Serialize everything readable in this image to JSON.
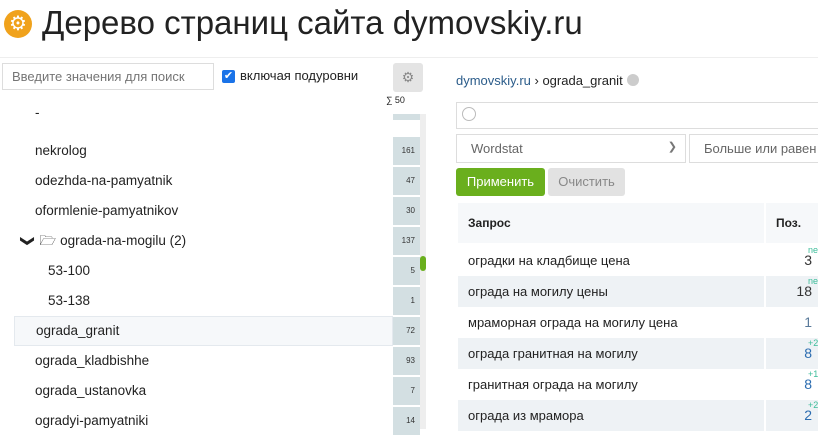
{
  "header": {
    "title": "Дерево страниц сайта dymovskiy.ru",
    "logo_icon": "gear-icon"
  },
  "left": {
    "search_placeholder": "Введите значения для поиск",
    "include_sublevels": "включая подуровни",
    "sum": "∑ 50",
    "rows": [
      {
        "label": "-",
        "count": ""
      },
      {
        "label": "nekrolog",
        "count": "161"
      },
      {
        "label": "odezhda-na-pamyatnik",
        "count": "47"
      },
      {
        "label": "oformlenie-pamyatnikov",
        "count": "30"
      },
      {
        "label": "ograda-na-mogilu (2)",
        "count": "137"
      },
      {
        "label": "53-100",
        "count": "5"
      },
      {
        "label": "53-138",
        "count": "1"
      },
      {
        "label": "ograda_granit",
        "count": "72"
      },
      {
        "label": "ograda_kladbishhe",
        "count": "93"
      },
      {
        "label": "ograda_ustanovka",
        "count": "7"
      },
      {
        "label": "ogradyi-pamyatniki",
        "count": "14"
      }
    ]
  },
  "right": {
    "crumb_root": "dymovskiy.ru",
    "crumb_sep": " › ",
    "crumb_page": "ograda_granit",
    "filter_select": "Wordstat",
    "filter_op": "Больше или равен",
    "apply": "Применить",
    "clear": "Очистить",
    "columns": [
      "Запрос",
      "Поз."
    ],
    "rows": [
      {
        "query": "оградки на кладбище цена",
        "pos": "3",
        "delta": "new",
        "color": "#333333"
      },
      {
        "query": "ограда на могилу цены",
        "pos": "18",
        "delta": "new",
        "color": "#333333"
      },
      {
        "query": "мраморная ограда на могилу цена",
        "pos": "1",
        "delta": "",
        "color": "#5a7a9a"
      },
      {
        "query": "ограда гранитная на могилу",
        "pos": "8",
        "delta": "+2",
        "color": "#2b6cb0"
      },
      {
        "query": "гранитная ограда на могилу",
        "pos": "8",
        "delta": "+1",
        "color": "#2b6cb0"
      },
      {
        "query": "ограда из мрамора",
        "pos": "2",
        "delta": "+2",
        "color": "#2b6cb0"
      }
    ]
  }
}
